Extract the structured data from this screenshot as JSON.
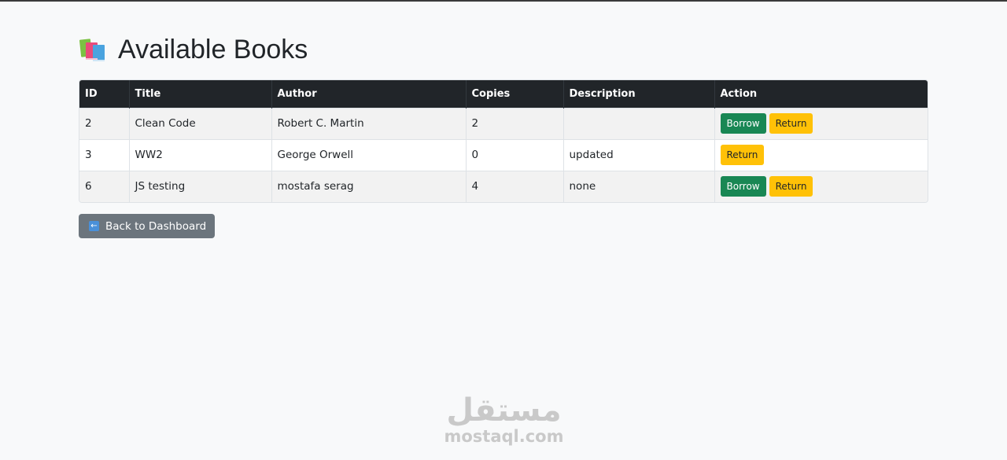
{
  "page": {
    "title": "Available Books",
    "title_icon": "books-icon"
  },
  "table": {
    "headers": [
      "ID",
      "Title",
      "Author",
      "Copies",
      "Description",
      "Action"
    ],
    "rows": [
      {
        "id": "2",
        "title": "Clean Code",
        "author": "Robert C. Martin",
        "copies": "2",
        "description": "",
        "actions": [
          "Borrow",
          "Return"
        ]
      },
      {
        "id": "3",
        "title": "WW2",
        "author": "George Orwell",
        "copies": "0",
        "description": "updated",
        "actions": [
          "Return"
        ]
      },
      {
        "id": "6",
        "title": "JS testing",
        "author": "mostafa serag",
        "copies": "4",
        "description": "none",
        "actions": [
          "Borrow",
          "Return"
        ]
      }
    ]
  },
  "back_button": {
    "label": "Back to Dashboard",
    "icon": "back-arrow-icon"
  },
  "watermark": {
    "arabic": "مستقل",
    "latin": "mostaql.com"
  },
  "colors": {
    "header_bg": "#212529",
    "borrow": "#198754",
    "return": "#ffc107",
    "secondary": "#6c757d",
    "page_bg": "#f8f9fa"
  }
}
